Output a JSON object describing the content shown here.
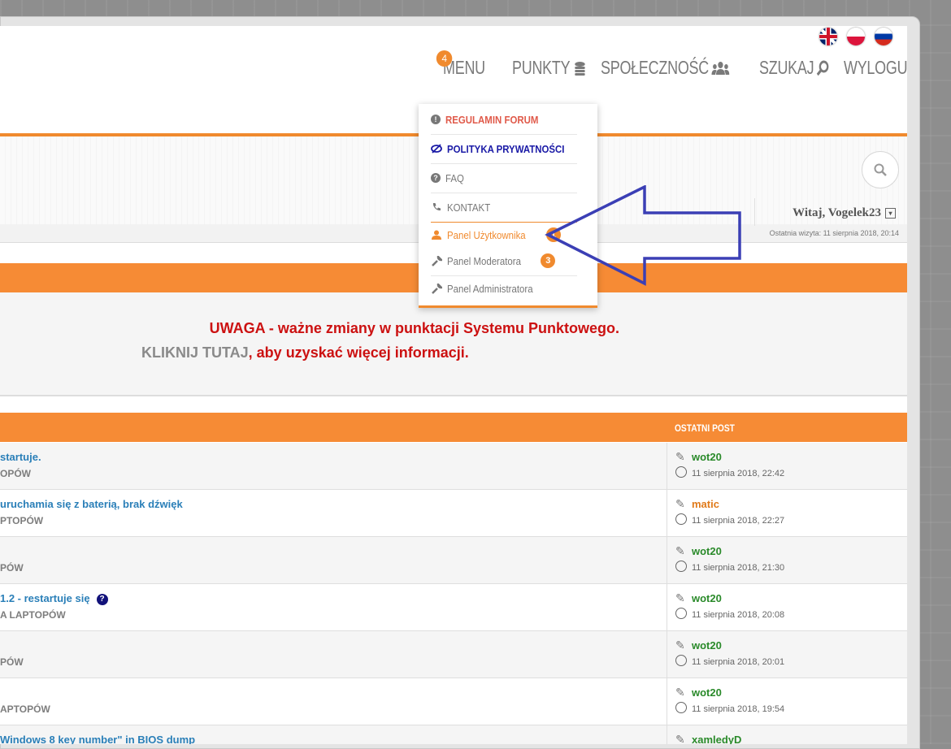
{
  "header": {
    "flags": [
      "English",
      "Polski",
      "Русский"
    ],
    "nav": {
      "menu_label": "MENU",
      "menu_badge": "4",
      "punkty_label": "PUNKTY",
      "spolecznosc_label": "SPOŁECZNOŚĆ",
      "szukaj_label": "SZUKAJ",
      "wyloguj_label": "WYLOGUJ"
    }
  },
  "user_bar": {
    "welcome": "Witaj, Vogelek23",
    "last_visit": "Ostatnia wizyta: 11 sierpnia 2018, 20:14"
  },
  "dropdown": {
    "items": [
      {
        "label": "REGULAMIN FORUM",
        "color": "#e05a4a",
        "icon": "exclamation-circle-icon"
      },
      {
        "label": "POLITYKA PRYWATNOŚCI",
        "color": "#1a1aa6",
        "icon": "eye-slash-icon"
      },
      {
        "label": "FAQ",
        "color": "#777777",
        "icon": "question-circle-icon"
      },
      {
        "label": "KONTAKT",
        "color": "#777777",
        "icon": "phone-icon"
      },
      {
        "label": "Panel Użytkownika",
        "color": "#f08a2e",
        "icon": "user-icon",
        "badge": "1"
      },
      {
        "label": "Panel Moderatora",
        "color": "#777777",
        "icon": "wrench-icon",
        "badge": "3"
      },
      {
        "label": "Panel Administratora",
        "color": "#777777",
        "icon": "wrench-icon"
      }
    ]
  },
  "notice": {
    "line1": "UWAGA - ważne zmiany w punktacji Systemu Punktowego.",
    "line2_link": "KLIKNIJ TUTAJ",
    "line2_rest": ", aby uzyskać więcej informacji."
  },
  "table": {
    "last_post_header": "OSTATNI POST",
    "rows": [
      {
        "topic": "startuje.",
        "forum": "OPÓW",
        "user": "wot20",
        "user_color": "#2a8a2a",
        "date": "11 sierpnia 2018, 22:42"
      },
      {
        "topic": "uruchamia się z baterią, brak dźwięk",
        "forum": "PTOPÓW",
        "user": "matic",
        "user_color": "#e07a1a",
        "date": "11 sierpnia 2018, 22:27"
      },
      {
        "topic": "",
        "forum": "PÓW",
        "user": "wot20",
        "user_color": "#2a8a2a",
        "date": "11 sierpnia 2018, 21:30"
      },
      {
        "topic": "1.2 - restartuje się",
        "forum": "A LAPTOPÓW",
        "user": "wot20",
        "user_color": "#2a8a2a",
        "date": "11 sierpnia 2018, 20:08",
        "question": true
      },
      {
        "topic": "",
        "forum": "PÓW",
        "user": "wot20",
        "user_color": "#2a8a2a",
        "date": "11 sierpnia 2018, 20:01"
      },
      {
        "topic": "",
        "forum": "APTOPÓW",
        "user": "wot20",
        "user_color": "#2a8a2a",
        "date": "11 sierpnia 2018, 19:54"
      },
      {
        "topic": "Windows 8 key number\" in BIOS dump",
        "forum": "",
        "user": "xamledyD",
        "user_color": "#2a8a2a",
        "date": ""
      }
    ]
  },
  "colors": {
    "accent": "#f08a2e",
    "header_bar": "#f68b35",
    "link_blue": "#2a7fb8",
    "warning_red": "#cc1111",
    "arrow_blue": "#3b3fb5"
  }
}
